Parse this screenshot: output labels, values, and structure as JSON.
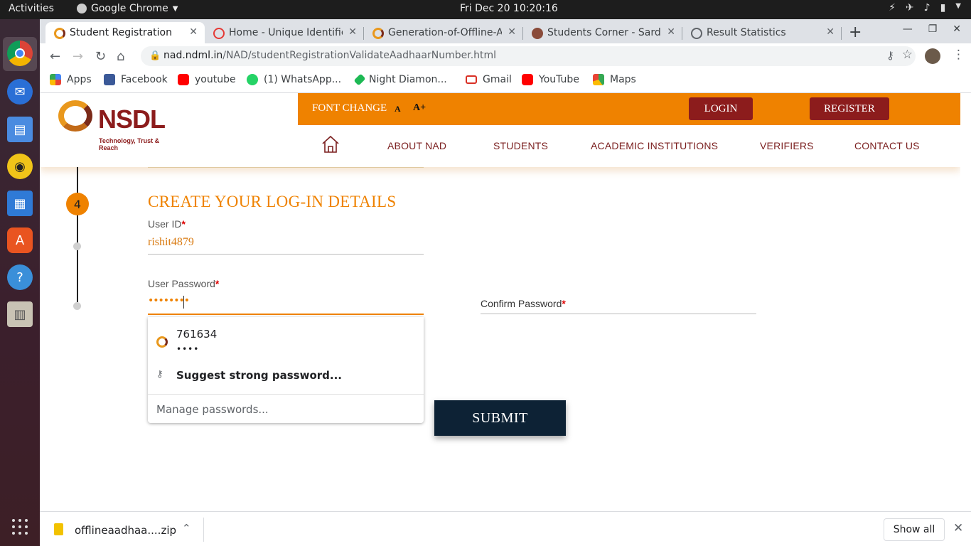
{
  "os": {
    "activities": "Activities",
    "app_name": "Google Chrome",
    "clock": "Fri Dec 20  10:20:16"
  },
  "browser": {
    "tabs": [
      {
        "label": "Student Registration",
        "active": true
      },
      {
        "label": "Home - Unique Identific",
        "active": false
      },
      {
        "label": "Generation-of-Offline-A",
        "active": false
      },
      {
        "label": "Students Corner - Sarda",
        "active": false
      },
      {
        "label": "Result Statistics",
        "active": false
      }
    ],
    "url_host": "nad.ndml.in",
    "url_path": "/NAD/studentRegistrationValidateAadhaarNumber.html",
    "bookmarks": [
      {
        "label": "Apps",
        "color": "#4285f4"
      },
      {
        "label": "Facebook",
        "color": "#3b5998"
      },
      {
        "label": "youtube",
        "color": "#ff0000"
      },
      {
        "label": "(1) WhatsApp...",
        "color": "#25d366"
      },
      {
        "label": "Night Diamon...",
        "color": "#1db954"
      },
      {
        "label": "Gmail",
        "color": "#d93025"
      },
      {
        "label": "YouTube",
        "color": "#ff0000"
      },
      {
        "label": "Maps",
        "color": "#34a853"
      }
    ]
  },
  "site": {
    "logo_name": "NSDL",
    "logo_tagline": "Technology, Trust & Reach",
    "font_change": "FONT CHANGE",
    "font_a": "A",
    "font_a_plus": "A+",
    "login": "LOGIN",
    "register": "REGISTER",
    "nav": [
      "ABOUT NAD",
      "STUDENTS",
      "ACADEMIC INSTITUTIONS",
      "VERIFIERS",
      "CONTACT US"
    ],
    "accent": "#ef8200",
    "brand": "#8c1c1c"
  },
  "form": {
    "step_number": "4",
    "heading": "CREATE YOUR LOG-IN DETAILS",
    "user_id_label": "User ID",
    "user_id_value": "rishit4879",
    "password_label": "User Password",
    "password_value": "••••••••",
    "confirm_label": "Confirm Password",
    "required_mark": "*",
    "submit": "SUBMIT"
  },
  "password_popup": {
    "saved_user": "761634",
    "saved_pass": "••••",
    "suggest": "Suggest strong password...",
    "manage": "Manage passwords..."
  },
  "downloads": {
    "file": "offlineaadhaa....zip",
    "show_all": "Show all"
  }
}
